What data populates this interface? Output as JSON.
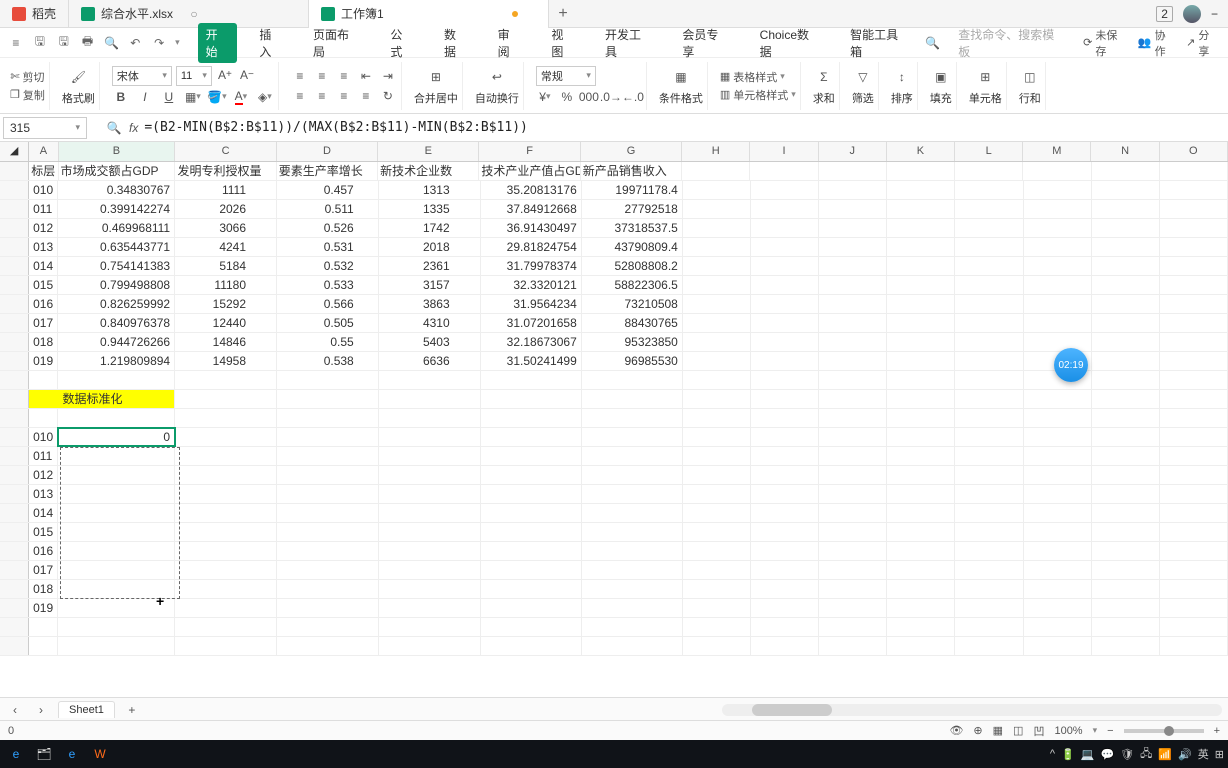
{
  "tabs": [
    {
      "icon": "red",
      "label": "稻壳"
    },
    {
      "icon": "green",
      "label": "综合水平.xlsx"
    },
    {
      "icon": "green",
      "label": "工作簿1",
      "active": true,
      "dirty": true
    }
  ],
  "window_badge": "2",
  "menu": [
    "开始",
    "插入",
    "页面布局",
    "公式",
    "数据",
    "审阅",
    "视图",
    "开发工具",
    "会员专享",
    "Choice数据",
    "智能工具箱"
  ],
  "menu_active_index": 0,
  "search_placeholder": "查找命令、搜索模板",
  "top_actions": {
    "unsaved": "未保存",
    "collab": "协作",
    "share": "分享"
  },
  "clipboard": {
    "cut": "剪切",
    "copy": "复制",
    "brush": "格式刷"
  },
  "font": {
    "name": "宋体",
    "size": "11"
  },
  "align": {
    "merge": "合并居中",
    "wrap": "自动换行"
  },
  "number": {
    "format": "常规"
  },
  "styles": {
    "cond": "条件格式",
    "table": "表格样式",
    "cell": "单元格样式"
  },
  "editing": {
    "sum": "求和",
    "filter": "筛选",
    "sort": "排序",
    "fill": "填充",
    "cells": "单元格",
    "rowcol": "行和"
  },
  "cell_ref": "315",
  "formula": "=(B2-MIN(B$2:B$11))/(MAX(B$2:B$11)-MIN(B$2:B$11))",
  "col_headers": [
    "A",
    "B",
    "C",
    "D",
    "E",
    "F",
    "G",
    "H",
    "I",
    "J",
    "K",
    "L",
    "M",
    "N",
    "O"
  ],
  "header_row": [
    "标层",
    "市场成交额占GDP",
    "发明专利授权量",
    "要素生产率增长",
    "新技术企业数",
    "技术产业产值占GDP",
    "新产品销售收入"
  ],
  "data_rows": [
    [
      "010",
      "0.34830767",
      "1111",
      "0.457",
      "1313",
      "35.20813176",
      "19971178.4"
    ],
    [
      "011",
      "0.399142274",
      "2026",
      "0.511",
      "1335",
      "37.84912668",
      "27792518"
    ],
    [
      "012",
      "0.469968111",
      "3066",
      "0.526",
      "1742",
      "36.91430497",
      "37318537.5"
    ],
    [
      "013",
      "0.635443771",
      "4241",
      "0.531",
      "2018",
      "29.81824754",
      "43790809.4"
    ],
    [
      "014",
      "0.754141383",
      "5184",
      "0.532",
      "2361",
      "31.79978374",
      "52808808.2"
    ],
    [
      "015",
      "0.799498808",
      "11180",
      "0.533",
      "3157",
      "32.3320121",
      "58822306.5"
    ],
    [
      "016",
      "0.826259992",
      "15292",
      "0.566",
      "3863",
      "31.9564234",
      "73210508"
    ],
    [
      "017",
      "0.840976378",
      "12440",
      "0.505",
      "4310",
      "31.07201658",
      "88430765"
    ],
    [
      "018",
      "0.944726266",
      "14846",
      "0.55",
      "5403",
      "32.18673067",
      "95323850"
    ],
    [
      "019",
      "1.219809894",
      "14958",
      "0.538",
      "6636",
      "31.50241499",
      "96985530"
    ]
  ],
  "section_label": "数据标准化",
  "norm_rows": [
    "010",
    "011",
    "012",
    "013",
    "014",
    "015",
    "016",
    "017",
    "018",
    "019"
  ],
  "norm_first_value": "0",
  "sheet": "Sheet1",
  "status_left": "0",
  "zoom": "100%",
  "timer": "02:19",
  "tray": {
    "ime": "英"
  },
  "chart_data": {
    "type": "table",
    "title": "",
    "columns": [
      "标层",
      "市场成交额占GDP",
      "发明专利授权量",
      "要素生产率增长",
      "新技术企业数",
      "技术产业产值占GDP",
      "新产品销售收入"
    ],
    "rows": [
      [
        "010",
        0.34830767,
        1111,
        0.457,
        1313,
        35.20813176,
        19971178.4
      ],
      [
        "011",
        0.399142274,
        2026,
        0.511,
        1335,
        37.84912668,
        27792518
      ],
      [
        "012",
        0.469968111,
        3066,
        0.526,
        1742,
        36.91430497,
        37318537.5
      ],
      [
        "013",
        0.635443771,
        4241,
        0.531,
        2018,
        29.81824754,
        43790809.4
      ],
      [
        "014",
        0.754141383,
        5184,
        0.532,
        2361,
        31.79978374,
        52808808.2
      ],
      [
        "015",
        0.799498808,
        11180,
        0.533,
        3157,
        32.3320121,
        58822306.5
      ],
      [
        "016",
        0.826259992,
        15292,
        0.566,
        3863,
        31.9564234,
        73210508
      ],
      [
        "017",
        0.840976378,
        12440,
        0.505,
        4310,
        31.07201658,
        88430765
      ],
      [
        "018",
        0.944726266,
        14846,
        0.55,
        5403,
        32.18673067,
        95323850
      ],
      [
        "019",
        1.219809894,
        14958,
        0.538,
        6636,
        31.50241499,
        96985530
      ]
    ]
  }
}
